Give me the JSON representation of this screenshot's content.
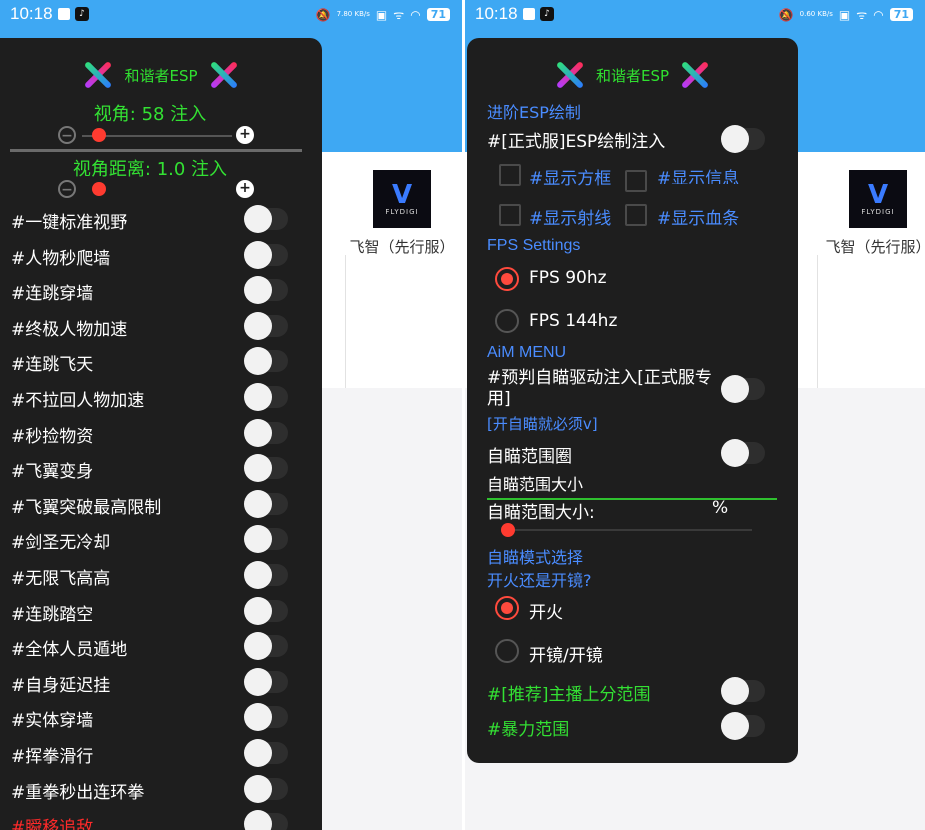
{
  "status_left": {
    "time": "10:18",
    "speed": "7.80 KB/s",
    "battery": "71"
  },
  "status_right": {
    "time": "10:18",
    "speed": "0.60 KB/s",
    "battery": "71"
  },
  "app_card": {
    "logo_text": "FLYDIGI",
    "name": "飞智（先行服）"
  },
  "left_menu": {
    "title": "和谐者ESP",
    "fov_label": "视角: 58  注入",
    "fov_value": 58,
    "fov_distance_label": "视角距离: 1.0  注入",
    "fov_distance_value": 1.0,
    "items": [
      {
        "label": "#一键标准视野",
        "on": false
      },
      {
        "label": "#人物秒爬墙",
        "on": false
      },
      {
        "label": "#连跳穿墙",
        "on": false
      },
      {
        "label": "#终极人物加速",
        "on": false
      },
      {
        "label": "#连跳飞天",
        "on": false
      },
      {
        "label": "#不拉回人物加速",
        "on": false
      },
      {
        "label": "#秒捡物资",
        "on": false
      },
      {
        "label": "#飞翼变身",
        "on": false
      },
      {
        "label": "#飞翼突破最高限制",
        "on": false
      },
      {
        "label": "#剑圣无冷却",
        "on": false
      },
      {
        "label": "#无限飞高高",
        "on": false
      },
      {
        "label": "#连跳踏空",
        "on": false
      },
      {
        "label": "#全体人员遁地",
        "on": false
      },
      {
        "label": "#自身延迟挂",
        "on": false
      },
      {
        "label": "#实体穿墙",
        "on": false
      },
      {
        "label": "#挥拳滑行",
        "on": false
      },
      {
        "label": "#重拳秒出连环拳",
        "on": false
      },
      {
        "label": "#瞬移追敌",
        "on": false
      }
    ]
  },
  "right_menu": {
    "title": "和谐者ESP",
    "esp_section": "进阶ESP绘制",
    "esp_inject": "#[正式服]ESP绘制注入",
    "checkboxes": [
      "#显示方框",
      "#显示信息",
      "#显示射线",
      "#显示血条"
    ],
    "fps_section": "FPS Settings",
    "fps_options": [
      "FPS 90hz",
      "FPS 144hz"
    ],
    "fps_selected": 0,
    "aim_section": "AiM MENU",
    "aim_predict": "#预判自瞄驱动注入[正式服专用]",
    "aim_note": "[开自瞄就必须v]",
    "aim_circle": "自瞄范围圈",
    "aim_size_input": "自瞄范围大小",
    "aim_size_label": "自瞄范围大小:",
    "aim_size_unit": "%",
    "mode_section": "自瞄模式选择",
    "mode_question": "开火还是开镜?",
    "mode_options": [
      "开火",
      "开镜/开镜"
    ],
    "mode_selected": 0,
    "recommend": "#[推荐]主播上分范围",
    "violent": "#暴力范围"
  },
  "colors": {
    "accent_blue": "#3ea8f3",
    "menu_bg": "#1e1e1e",
    "green": "#33e033",
    "link_blue": "#4a8cff",
    "red": "#ff2a2a",
    "radio_red": "#ff4a3d"
  }
}
